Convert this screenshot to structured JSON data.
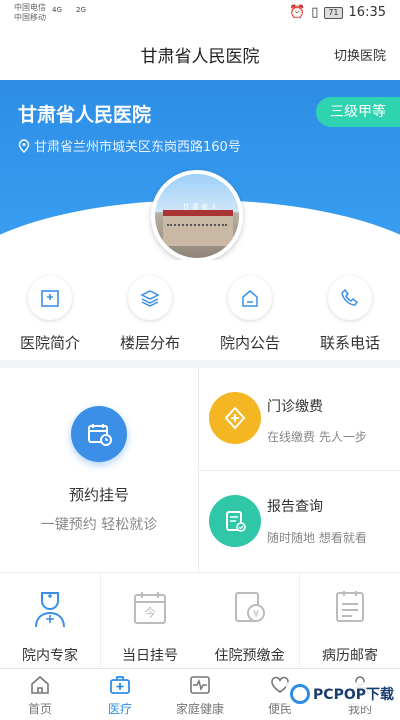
{
  "status_bar": {
    "carrier1": "中国电信",
    "carrier2": "中国移动",
    "signal1": "4G",
    "signal2": "2G",
    "battery": "71",
    "time": "16:35"
  },
  "navbar": {
    "title": "甘肃省人民医院",
    "switch_label": "切换医院"
  },
  "hero": {
    "hospital_name": "甘肃省人民医院",
    "level_badge": "三级甲等",
    "address": "甘肃省兰州市城关区东岗西路160号",
    "building_sign": "甘 肃 省 人"
  },
  "quick_links": [
    {
      "label": "医院简介",
      "icon": "hospital-building-icon"
    },
    {
      "label": "楼层分布",
      "icon": "layers-icon"
    },
    {
      "label": "院内公告",
      "icon": "notice-icon"
    },
    {
      "label": "联系电话",
      "icon": "phone-icon"
    }
  ],
  "services": {
    "appointment": {
      "title": "预约挂号",
      "subtitle": "一键预约 轻松就诊",
      "icon": "calendar-clock-icon"
    },
    "outpatient_pay": {
      "title": "门诊缴费",
      "subtitle": "在线缴费 先人一步",
      "icon": "medical-cross-icon",
      "color": "#f5b623"
    },
    "report_query": {
      "title": "报告查询",
      "subtitle": "随时随地 想看就看",
      "icon": "report-check-icon",
      "color": "#2fc7a8"
    },
    "row": [
      {
        "title": "院内专家",
        "icon": "doctor-icon"
      },
      {
        "title": "当日挂号",
        "icon": "today-calendar-icon"
      },
      {
        "title": "住院预缴金",
        "icon": "prepay-icon"
      },
      {
        "title": "病历邮寄",
        "icon": "mail-record-icon"
      }
    ]
  },
  "tabbar": [
    {
      "label": "首页",
      "icon": "home-icon",
      "active": false
    },
    {
      "label": "医疗",
      "icon": "medical-kit-icon",
      "active": true
    },
    {
      "label": "家庭健康",
      "icon": "heart-monitor-icon",
      "active": false
    },
    {
      "label": "便民",
      "icon": "heart-hand-icon",
      "active": false
    },
    {
      "label": "我的",
      "icon": "user-icon",
      "active": false
    }
  ],
  "watermark": {
    "text": "PCPOP下载"
  },
  "colors": {
    "primary": "#2d8de6",
    "badge": "#2fd3b0"
  }
}
